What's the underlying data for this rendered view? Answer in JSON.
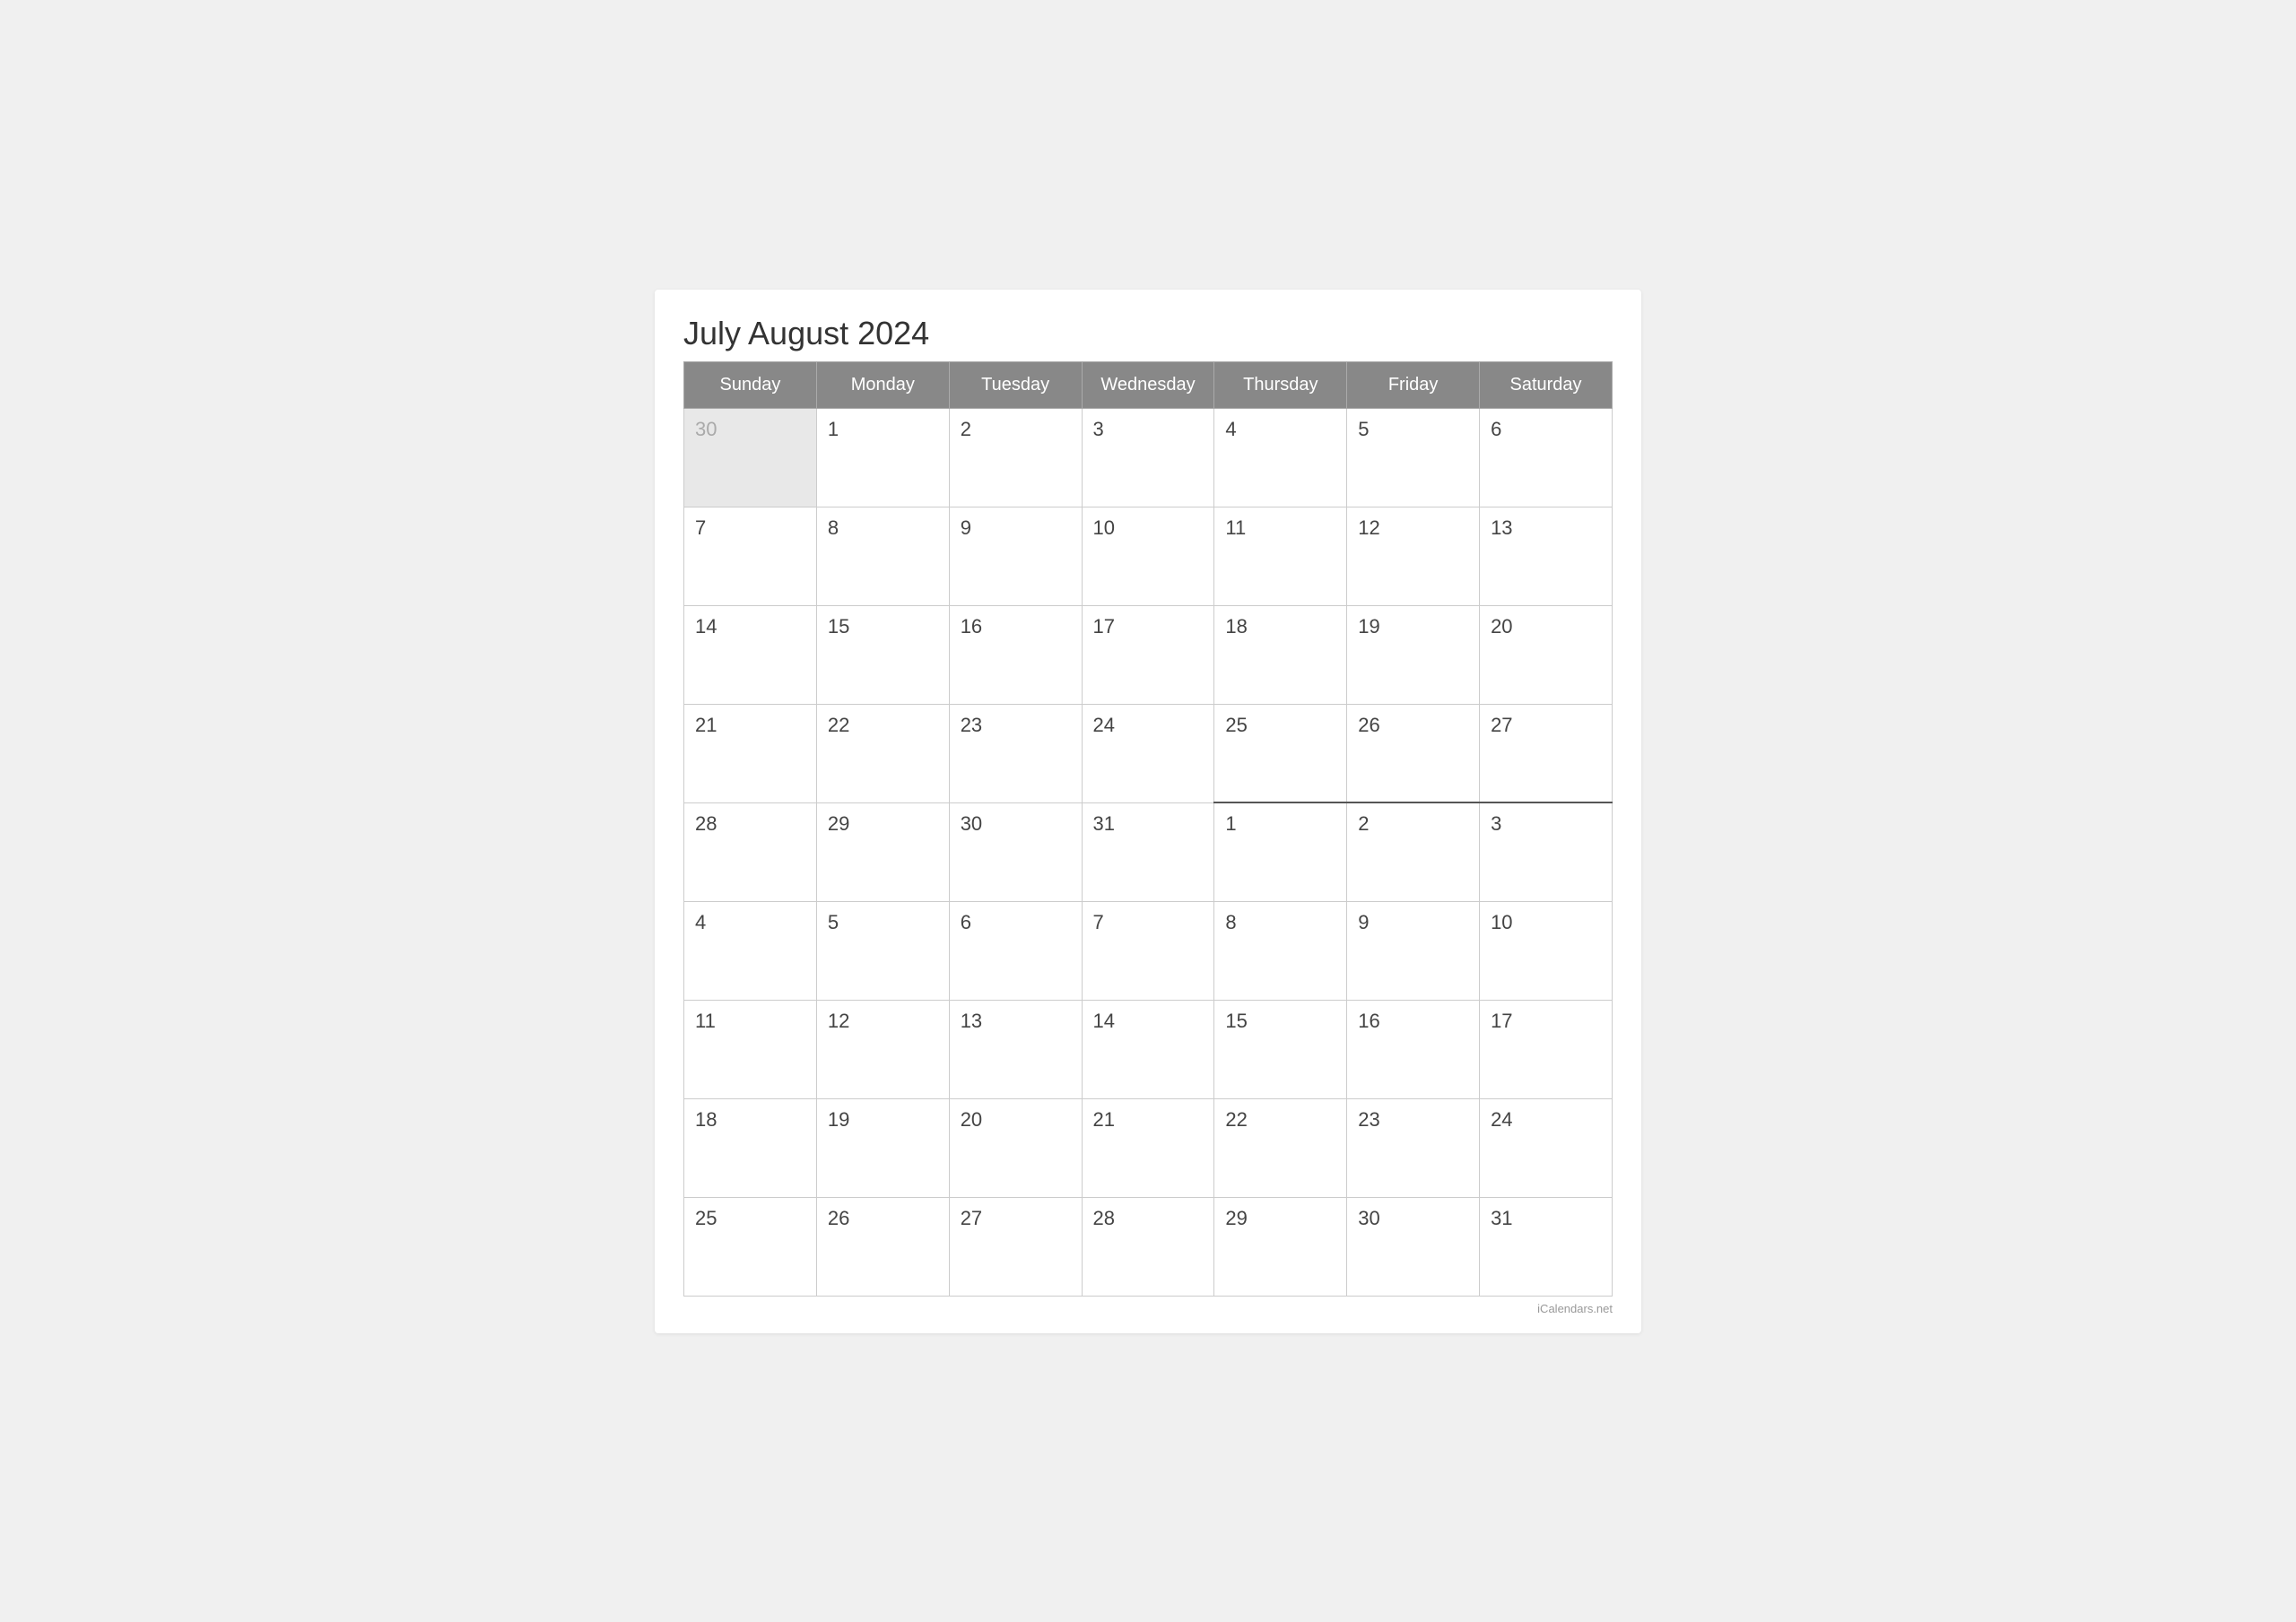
{
  "title": "July August 2024",
  "watermark": "iCalendars.net",
  "header": {
    "days": [
      "Sunday",
      "Monday",
      "Tuesday",
      "Wednesday",
      "Thursday",
      "Friday",
      "Saturday"
    ]
  },
  "rows": [
    {
      "cells": [
        {
          "day": "30",
          "grayed": true,
          "aug_start": false
        },
        {
          "day": "1",
          "grayed": false,
          "aug_start": false
        },
        {
          "day": "2",
          "grayed": false,
          "aug_start": false
        },
        {
          "day": "3",
          "grayed": false,
          "aug_start": false
        },
        {
          "day": "4",
          "grayed": false,
          "aug_start": false
        },
        {
          "day": "5",
          "grayed": false,
          "aug_start": false
        },
        {
          "day": "6",
          "grayed": false,
          "aug_start": false
        }
      ]
    },
    {
      "cells": [
        {
          "day": "7",
          "grayed": false,
          "aug_start": false
        },
        {
          "day": "8",
          "grayed": false,
          "aug_start": false
        },
        {
          "day": "9",
          "grayed": false,
          "aug_start": false
        },
        {
          "day": "10",
          "grayed": false,
          "aug_start": false
        },
        {
          "day": "11",
          "grayed": false,
          "aug_start": false
        },
        {
          "day": "12",
          "grayed": false,
          "aug_start": false
        },
        {
          "day": "13",
          "grayed": false,
          "aug_start": false
        }
      ]
    },
    {
      "cells": [
        {
          "day": "14",
          "grayed": false,
          "aug_start": false
        },
        {
          "day": "15",
          "grayed": false,
          "aug_start": false
        },
        {
          "day": "16",
          "grayed": false,
          "aug_start": false
        },
        {
          "day": "17",
          "grayed": false,
          "aug_start": false
        },
        {
          "day": "18",
          "grayed": false,
          "aug_start": false
        },
        {
          "day": "19",
          "grayed": false,
          "aug_start": false
        },
        {
          "day": "20",
          "grayed": false,
          "aug_start": false
        }
      ]
    },
    {
      "cells": [
        {
          "day": "21",
          "grayed": false,
          "aug_start": false
        },
        {
          "day": "22",
          "grayed": false,
          "aug_start": false
        },
        {
          "day": "23",
          "grayed": false,
          "aug_start": false
        },
        {
          "day": "24",
          "grayed": false,
          "aug_start": false
        },
        {
          "day": "25",
          "grayed": false,
          "aug_start": false
        },
        {
          "day": "26",
          "grayed": false,
          "aug_start": false
        },
        {
          "day": "27",
          "grayed": false,
          "aug_start": false
        }
      ]
    },
    {
      "cells": [
        {
          "day": "28",
          "grayed": false,
          "aug_start": false
        },
        {
          "day": "29",
          "grayed": false,
          "aug_start": false
        },
        {
          "day": "30",
          "grayed": false,
          "aug_start": false
        },
        {
          "day": "31",
          "grayed": false,
          "aug_start": false
        },
        {
          "day": "1",
          "grayed": false,
          "aug_start": true
        },
        {
          "day": "2",
          "grayed": false,
          "aug_start": true
        },
        {
          "day": "3",
          "grayed": false,
          "aug_start": true
        }
      ]
    },
    {
      "cells": [
        {
          "day": "4",
          "grayed": false,
          "aug_start": false
        },
        {
          "day": "5",
          "grayed": false,
          "aug_start": false
        },
        {
          "day": "6",
          "grayed": false,
          "aug_start": false
        },
        {
          "day": "7",
          "grayed": false,
          "aug_start": false
        },
        {
          "day": "8",
          "grayed": false,
          "aug_start": false
        },
        {
          "day": "9",
          "grayed": false,
          "aug_start": false
        },
        {
          "day": "10",
          "grayed": false,
          "aug_start": false
        }
      ]
    },
    {
      "cells": [
        {
          "day": "11",
          "grayed": false,
          "aug_start": false
        },
        {
          "day": "12",
          "grayed": false,
          "aug_start": false
        },
        {
          "day": "13",
          "grayed": false,
          "aug_start": false
        },
        {
          "day": "14",
          "grayed": false,
          "aug_start": false
        },
        {
          "day": "15",
          "grayed": false,
          "aug_start": false
        },
        {
          "day": "16",
          "grayed": false,
          "aug_start": false
        },
        {
          "day": "17",
          "grayed": false,
          "aug_start": false
        }
      ]
    },
    {
      "cells": [
        {
          "day": "18",
          "grayed": false,
          "aug_start": false
        },
        {
          "day": "19",
          "grayed": false,
          "aug_start": false
        },
        {
          "day": "20",
          "grayed": false,
          "aug_start": false
        },
        {
          "day": "21",
          "grayed": false,
          "aug_start": false
        },
        {
          "day": "22",
          "grayed": false,
          "aug_start": false
        },
        {
          "day": "23",
          "grayed": false,
          "aug_start": false
        },
        {
          "day": "24",
          "grayed": false,
          "aug_start": false
        }
      ]
    },
    {
      "cells": [
        {
          "day": "25",
          "grayed": false,
          "aug_start": false
        },
        {
          "day": "26",
          "grayed": false,
          "aug_start": false
        },
        {
          "day": "27",
          "grayed": false,
          "aug_start": false
        },
        {
          "day": "28",
          "grayed": false,
          "aug_start": false
        },
        {
          "day": "29",
          "grayed": false,
          "aug_start": false
        },
        {
          "day": "30",
          "grayed": false,
          "aug_start": false
        },
        {
          "day": "31",
          "grayed": false,
          "aug_start": false
        }
      ]
    }
  ]
}
